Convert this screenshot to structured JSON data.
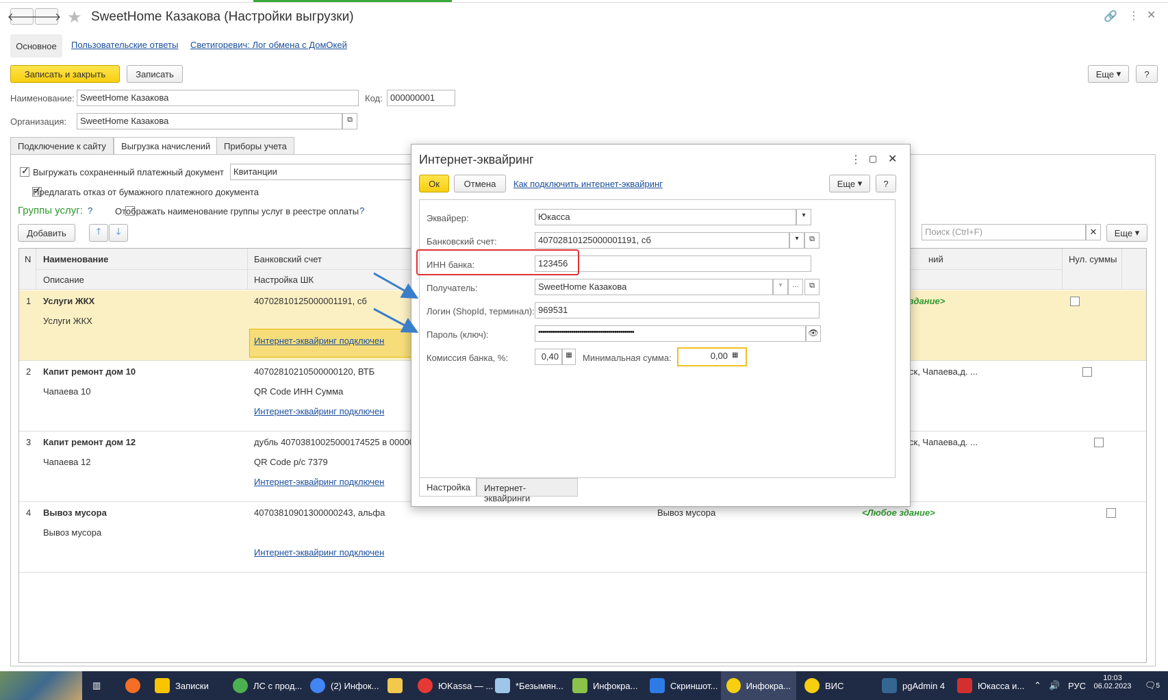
{
  "window": {
    "title": "SweetHome Казакова (Настройки выгрузки)",
    "nav_tabs": [
      "Основное",
      "Пользовательские ответы",
      "Светигоревич: Лог обмена с ДомОкей"
    ],
    "btn_save_close": "Записать и закрыть",
    "btn_save": "Записать",
    "btn_more": "Еще",
    "btn_help": "?"
  },
  "form": {
    "name_label": "Наименование:",
    "name_value": "SweetHome Казакова",
    "code_label": "Код:",
    "code_value": "000000001",
    "org_label": "Организация:",
    "org_value": "SweetHome Казакова"
  },
  "tabs": [
    "Подключение к сайту",
    "Выгрузка начислений",
    "Приборы учета"
  ],
  "options": {
    "export_doc_label": "Выгружать сохраненный платежный документ",
    "export_doc_value": "Квитанции",
    "refuse_paper_label": "Предлагать отказ от бумажного платежного документа",
    "service_groups_label": "Группы услуг:",
    "q": "?",
    "show_group_name_label": "Отображать наименование группы услуг в реестре оплаты",
    "add_button": "Добавить",
    "search_placeholder": "Поиск (Ctrl+F)",
    "more": "Еще"
  },
  "grid": {
    "headers": {
      "n": "N",
      "name": "Наименование",
      "desc": "Описание",
      "account": "Банковский счет",
      "shk": "Настройка ШК",
      "right_partial": "ний",
      "nul": "Нул. суммы"
    },
    "rows": [
      {
        "n": "1",
        "name": "Услуги ЖКХ",
        "desc": "Услуги ЖКХ",
        "account": "40702810125000001191, сб",
        "shk": "",
        "link": "Интернет-эквайринг подключен",
        "col5": "",
        "col6": "здание>"
      },
      {
        "n": "2",
        "name": "Капит ремонт дом 10",
        "desc": "Чапаева 10",
        "account": "40702810210500000120, ВТБ",
        "shk": "QR Code ИНН Сумма",
        "link": "Интернет-эквайринг подключен",
        "col5": "",
        "col6": "ск, Чапаева,д. ..."
      },
      {
        "n": "3",
        "name": "Капит ремонт дом 12",
        "desc": "Чапаева 12",
        "account": "дубль 40703810025000174525 в 00000",
        "shk": "QR Code р/с 7379",
        "link": "Интернет-эквайринг подключен",
        "col5": "",
        "col6": "ск, Чапаева,д. ..."
      },
      {
        "n": "4",
        "name": "Вывоз мусора",
        "desc": "Вывоз мусора",
        "account": "40703810901300000243, альфа",
        "shk": "",
        "link": "Интернет-эквайринг подключен",
        "col5": "Вывоз мусора",
        "col6": "<Любое здание>"
      }
    ]
  },
  "dialog": {
    "title": "Интернет-эквайринг",
    "ok": "Ок",
    "cancel": "Отмена",
    "howto_link": "Как подключить интернет-эквайринг",
    "more": "Еще",
    "help": "?",
    "acquirer_label": "Эквайрер:",
    "acquirer_value": "Юкасса",
    "account_label": "Банковский счет:",
    "account_value": "40702810125000001191, сб",
    "inn_label": "ИНН банка:",
    "inn_value": "123456",
    "recipient_label": "Получатель:",
    "recipient_value": "SweetHome Казакова",
    "login_label": "Логин (ShopId, терминал):",
    "login_value": "969531",
    "password_label": "Пароль (ключ):",
    "password_value": "•••••••••••••••••••••••••••••••••••••••••••••••••",
    "commission_label": "Комиссия банка, %:",
    "commission_value": "0,40",
    "min_sum_label": "Минимальная сумма:",
    "min_sum_value": "0,00",
    "tabs": [
      "Настройка",
      "Интернет-эквайринги"
    ]
  },
  "taskbar": {
    "items": [
      "Записки",
      "ЛС с прод...",
      "(2) Инфок...",
      "ЮKassa — ...",
      "*Безымян...",
      "Инфокра...",
      "Скриншот...",
      "Инфокра...",
      "ВИС",
      "pgAdmin 4",
      "Юкасса и..."
    ],
    "lang": "РУС",
    "time": "10:03",
    "date": "06.02.2023",
    "notif": "5"
  },
  "colors": {
    "accent_yellow": "#f7cf10",
    "link": "#1a4e9c",
    "selection": "#fbf0c3",
    "arrow": "#3a7dc9",
    "highlight_red": "#e03030"
  }
}
